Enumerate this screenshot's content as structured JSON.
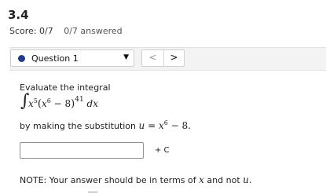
{
  "assignment": {
    "title": "3.4",
    "score_label": "Score: 0/7",
    "answered_label": "0/7 answered"
  },
  "question_nav": {
    "selected_question": "Question 1",
    "prev_glyph": "<",
    "next_glyph": ">",
    "status_color": "#1f3b8c"
  },
  "problem": {
    "prompt": "Evaluate the integral",
    "integral": {
      "outer_exponent": "41",
      "x_power": "5",
      "inner_power": "6",
      "constant": "8",
      "differential": "dx"
    },
    "substitution_prefix": "by making the substitution",
    "substitution_var": "u",
    "substitution_power": "6",
    "substitution_const": "8"
  },
  "answer": {
    "value": "",
    "constant_label": "+ C"
  },
  "note": {
    "prefix": "NOTE: Your answer should be in terms of",
    "var1": "x",
    "middle": "and not",
    "var2": "u."
  }
}
